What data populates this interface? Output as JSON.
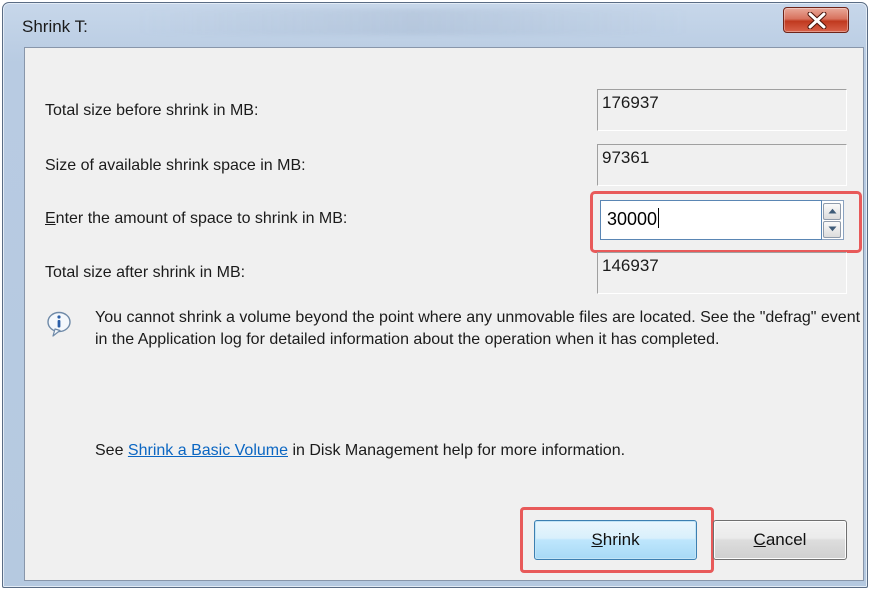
{
  "dialog": {
    "title": "Shrink T:"
  },
  "fields": {
    "total_before": {
      "label": "Total size before shrink in MB:",
      "value": "176937"
    },
    "available": {
      "label": "Size of available shrink space in MB:",
      "value": "97361"
    },
    "amount": {
      "label_accesskey": "E",
      "label_rest": "nter the amount of space to shrink in MB:",
      "value": "30000"
    },
    "total_after": {
      "label": "Total size after shrink in MB:",
      "value": "146937"
    }
  },
  "info": {
    "message": "You cannot shrink a volume beyond the point where any unmovable files are located. See the \"defrag\" event in the Application log for detailed information about the operation when it has completed."
  },
  "help": {
    "prefix": "See ",
    "link_text": "Shrink a Basic Volume",
    "suffix": " in Disk Management help for more information."
  },
  "buttons": {
    "shrink_accesskey": "S",
    "shrink_rest": "hrink",
    "cancel_accesskey": "C",
    "cancel_rest": "ancel"
  },
  "colors": {
    "highlight": "#e85a5a",
    "link": "#0b66c2",
    "close_button": "#c0391f"
  },
  "icons": {
    "close": "close-icon",
    "info": "info-icon",
    "spin_up": "spin-up-arrow-icon",
    "spin_down": "spin-down-arrow-icon"
  }
}
